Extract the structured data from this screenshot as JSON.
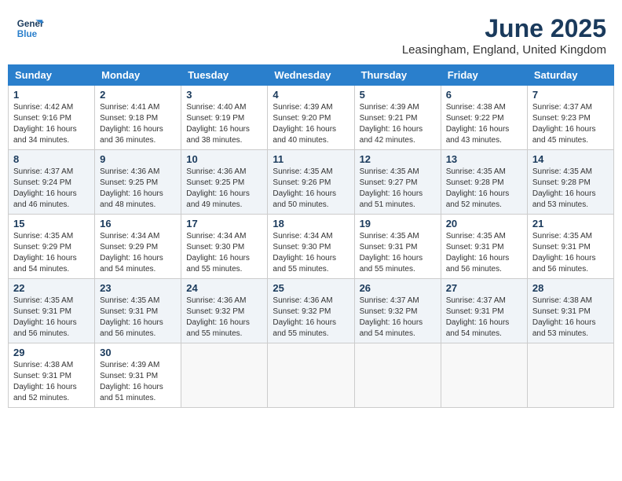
{
  "header": {
    "logo_line1": "General",
    "logo_line2": "Blue",
    "month": "June 2025",
    "location": "Leasingham, England, United Kingdom"
  },
  "weekdays": [
    "Sunday",
    "Monday",
    "Tuesday",
    "Wednesday",
    "Thursday",
    "Friday",
    "Saturday"
  ],
  "weeks": [
    [
      {
        "day": "1",
        "sunrise": "4:42 AM",
        "sunset": "9:16 PM",
        "daylight": "16 hours and 34 minutes."
      },
      {
        "day": "2",
        "sunrise": "4:41 AM",
        "sunset": "9:18 PM",
        "daylight": "16 hours and 36 minutes."
      },
      {
        "day": "3",
        "sunrise": "4:40 AM",
        "sunset": "9:19 PM",
        "daylight": "16 hours and 38 minutes."
      },
      {
        "day": "4",
        "sunrise": "4:39 AM",
        "sunset": "9:20 PM",
        "daylight": "16 hours and 40 minutes."
      },
      {
        "day": "5",
        "sunrise": "4:39 AM",
        "sunset": "9:21 PM",
        "daylight": "16 hours and 42 minutes."
      },
      {
        "day": "6",
        "sunrise": "4:38 AM",
        "sunset": "9:22 PM",
        "daylight": "16 hours and 43 minutes."
      },
      {
        "day": "7",
        "sunrise": "4:37 AM",
        "sunset": "9:23 PM",
        "daylight": "16 hours and 45 minutes."
      }
    ],
    [
      {
        "day": "8",
        "sunrise": "4:37 AM",
        "sunset": "9:24 PM",
        "daylight": "16 hours and 46 minutes."
      },
      {
        "day": "9",
        "sunrise": "4:36 AM",
        "sunset": "9:25 PM",
        "daylight": "16 hours and 48 minutes."
      },
      {
        "day": "10",
        "sunrise": "4:36 AM",
        "sunset": "9:25 PM",
        "daylight": "16 hours and 49 minutes."
      },
      {
        "day": "11",
        "sunrise": "4:35 AM",
        "sunset": "9:26 PM",
        "daylight": "16 hours and 50 minutes."
      },
      {
        "day": "12",
        "sunrise": "4:35 AM",
        "sunset": "9:27 PM",
        "daylight": "16 hours and 51 minutes."
      },
      {
        "day": "13",
        "sunrise": "4:35 AM",
        "sunset": "9:28 PM",
        "daylight": "16 hours and 52 minutes."
      },
      {
        "day": "14",
        "sunrise": "4:35 AM",
        "sunset": "9:28 PM",
        "daylight": "16 hours and 53 minutes."
      }
    ],
    [
      {
        "day": "15",
        "sunrise": "4:35 AM",
        "sunset": "9:29 PM",
        "daylight": "16 hours and 54 minutes."
      },
      {
        "day": "16",
        "sunrise": "4:34 AM",
        "sunset": "9:29 PM",
        "daylight": "16 hours and 54 minutes."
      },
      {
        "day": "17",
        "sunrise": "4:34 AM",
        "sunset": "9:30 PM",
        "daylight": "16 hours and 55 minutes."
      },
      {
        "day": "18",
        "sunrise": "4:34 AM",
        "sunset": "9:30 PM",
        "daylight": "16 hours and 55 minutes."
      },
      {
        "day": "19",
        "sunrise": "4:35 AM",
        "sunset": "9:31 PM",
        "daylight": "16 hours and 55 minutes."
      },
      {
        "day": "20",
        "sunrise": "4:35 AM",
        "sunset": "9:31 PM",
        "daylight": "16 hours and 56 minutes."
      },
      {
        "day": "21",
        "sunrise": "4:35 AM",
        "sunset": "9:31 PM",
        "daylight": "16 hours and 56 minutes."
      }
    ],
    [
      {
        "day": "22",
        "sunrise": "4:35 AM",
        "sunset": "9:31 PM",
        "daylight": "16 hours and 56 minutes."
      },
      {
        "day": "23",
        "sunrise": "4:35 AM",
        "sunset": "9:31 PM",
        "daylight": "16 hours and 56 minutes."
      },
      {
        "day": "24",
        "sunrise": "4:36 AM",
        "sunset": "9:32 PM",
        "daylight": "16 hours and 55 minutes."
      },
      {
        "day": "25",
        "sunrise": "4:36 AM",
        "sunset": "9:32 PM",
        "daylight": "16 hours and 55 minutes."
      },
      {
        "day": "26",
        "sunrise": "4:37 AM",
        "sunset": "9:32 PM",
        "daylight": "16 hours and 54 minutes."
      },
      {
        "day": "27",
        "sunrise": "4:37 AM",
        "sunset": "9:31 PM",
        "daylight": "16 hours and 54 minutes."
      },
      {
        "day": "28",
        "sunrise": "4:38 AM",
        "sunset": "9:31 PM",
        "daylight": "16 hours and 53 minutes."
      }
    ],
    [
      {
        "day": "29",
        "sunrise": "4:38 AM",
        "sunset": "9:31 PM",
        "daylight": "16 hours and 52 minutes."
      },
      {
        "day": "30",
        "sunrise": "4:39 AM",
        "sunset": "9:31 PM",
        "daylight": "16 hours and 51 minutes."
      },
      null,
      null,
      null,
      null,
      null
    ]
  ],
  "labels": {
    "sunrise_label": "Sunrise:",
    "sunset_label": "Sunset:",
    "daylight_label": "Daylight:"
  }
}
